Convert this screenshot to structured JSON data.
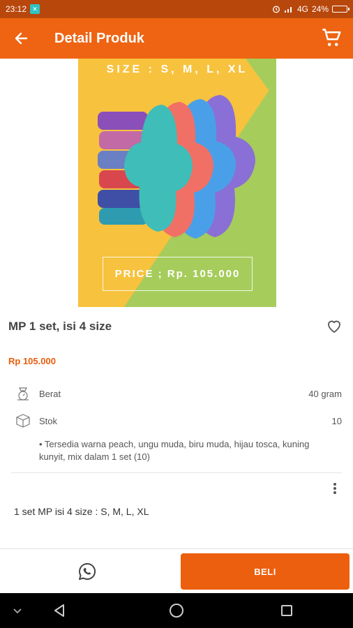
{
  "status_bar": {
    "time": "23:12",
    "network": "4G",
    "battery_percent": "24%",
    "battery_level": 0.24
  },
  "app_bar": {
    "title": "Detail Produk",
    "back_icon": "arrow-back-icon",
    "cart_icon": "cart-icon"
  },
  "product_image": {
    "size_text": "SIZE : S, M, L, XL",
    "price_text": "PRICE ; Rp. 105.000"
  },
  "product": {
    "title": "MP 1 set, isi 4 size",
    "price": "Rp 105.000"
  },
  "specs": [
    {
      "icon": "scale-icon",
      "label": "Berat",
      "value": "40 gram"
    },
    {
      "icon": "box-icon",
      "label": "Stok",
      "value": "10"
    }
  ],
  "note": "• Tersedia warna peach, ungu muda,  biru muda, hijau tosca, kuning kunyit, mix dalam 1 set (10)",
  "description": "1 set MP isi 4 size : S, M, L, XL",
  "bottom_bar": {
    "whatsapp_icon": "whatsapp-icon",
    "buy_label": "BELI"
  },
  "colors": {
    "status_bar": "#b8470c",
    "app_bar": "#ee6412",
    "price": "#e85d0c",
    "buy_button": "#ec5f0e"
  }
}
